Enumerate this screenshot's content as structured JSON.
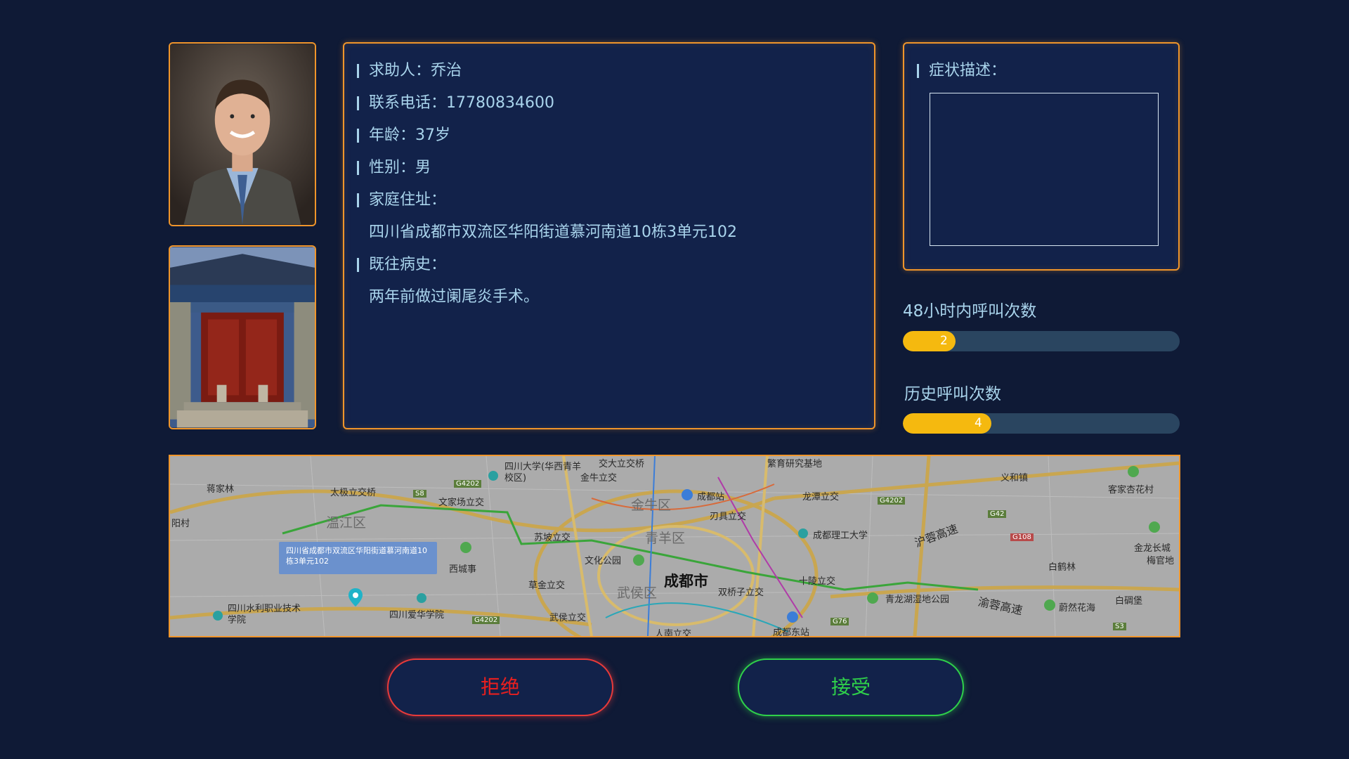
{
  "patient": {
    "name_label": "求助人：",
    "name": "乔治",
    "phone_label": "联系电话：",
    "phone": "17780834600",
    "age_label": "年龄：",
    "age": "37岁",
    "gender_label": "性别：",
    "gender": "男",
    "address_label": "家庭住址：",
    "address": "四川省成都市双流区华阳街道慕河南道10栋3单元102",
    "history_label": "既往病史：",
    "history": "两年前做过阑尾炎手术。"
  },
  "symptom": {
    "label": "症状描述：",
    "value": ""
  },
  "stats": {
    "calls_48h_label": "48小时内呼叫次数",
    "calls_48h": "2",
    "calls_48h_fraction": 0.19,
    "calls_history_label": "历史呼叫次数",
    "calls_history": "4",
    "calls_history_fraction": 0.32
  },
  "map": {
    "popup": "四川省成都市双流区华阳街道慕河南道10栋3单元102",
    "labels": {
      "l1": "蒋家林",
      "l2": "太极立交桥",
      "l3": "四川大学(华西青羊校区)",
      "l4": "交大立交桥",
      "l5": "金牛立交",
      "l6": "繁育研究基地",
      "l7": "成都站",
      "l8": "龙潭立交",
      "l9": "义和镇",
      "l10": "客家杏花村",
      "l11": "阳村",
      "l12": "温江区",
      "l13": "文家场立交",
      "l14": "金牛区",
      "l15": "刃具立交",
      "l16": "苏坡立交",
      "l17": "青羊区",
      "l18": "成都理工大学",
      "l19": "沪蓉高速",
      "l20": "金龙长城",
      "l21": "梅官地",
      "l22": "西城事",
      "l23": "文化公园",
      "l24": "白鹤林",
      "l25": "成都市",
      "l26": "草金立交",
      "l27": "武侯区",
      "l28": "双桥子立交",
      "l29": "十陵立交",
      "l30": "青龙湖湿地公园",
      "l31": "渝蓉高速",
      "l32": "蔚然花海",
      "l33": "白碉堡",
      "l34": "四川水利职业技术学院",
      "l35": "四川爱华学院",
      "l36": "武侯立交",
      "l37": "成都东站",
      "l38": "人南立交",
      "s1": "G4202",
      "s2": "S8",
      "s3": "G4202",
      "s4": "G42",
      "s5": "G108",
      "s6": "G4202",
      "s7": "G76",
      "s8": "S3"
    }
  },
  "buttons": {
    "reject": "拒绝",
    "accept": "接受"
  },
  "colors": {
    "background": "#0f1a36",
    "panel_border": "#f0952a",
    "text": "#a9d4ec",
    "progress_fill": "#f5b90f",
    "reject": "#e81f1f",
    "accept": "#2fd04a"
  }
}
